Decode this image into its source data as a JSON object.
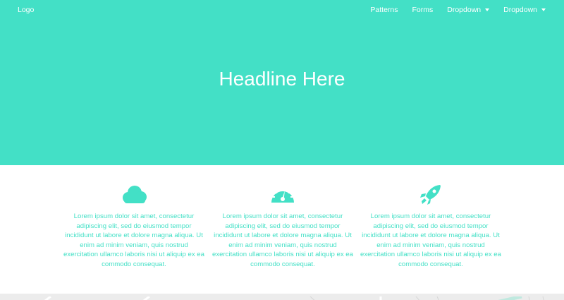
{
  "colors": {
    "accent": "#43e0c6",
    "white": "#ffffff",
    "map_bg": "#ececec"
  },
  "nav": {
    "logo": "Logo",
    "items": [
      {
        "label": "Patterns",
        "dropdown": false
      },
      {
        "label": "Forms",
        "dropdown": false
      },
      {
        "label": "Dropdown",
        "dropdown": true
      },
      {
        "label": "Dropdown",
        "dropdown": true
      }
    ]
  },
  "hero": {
    "headline": "Headline Here"
  },
  "features": [
    {
      "icon": "cloud-icon",
      "text": "Lorem ipsum dolor sit amet, consectetur adipiscing elit, sed do eiusmod tempor incididunt ut labore et dolore magna aliqua. Ut enim ad minim veniam, quis nostrud exercitation ullamco laboris nisi ut aliquip ex ea commodo consequat."
    },
    {
      "icon": "speedometer-icon",
      "text": "Lorem ipsum dolor sit amet, consectetur adipiscing elit, sed do eiusmod tempor incididunt ut labore et dolore magna aliqua. Ut enim ad minim veniam, quis nostrud exercitation ullamco laboris nisi ut aliquip ex ea commodo consequat."
    },
    {
      "icon": "rocket-icon",
      "text": "Lorem ipsum dolor sit amet, consectetur adipiscing elit, sed do eiusmod tempor incididunt ut labore et dolore magna aliqua. Ut enim ad minim veniam, quis nostrud exercitation ullamco laboris nisi ut aliquip ex ea commodo consequat."
    }
  ]
}
